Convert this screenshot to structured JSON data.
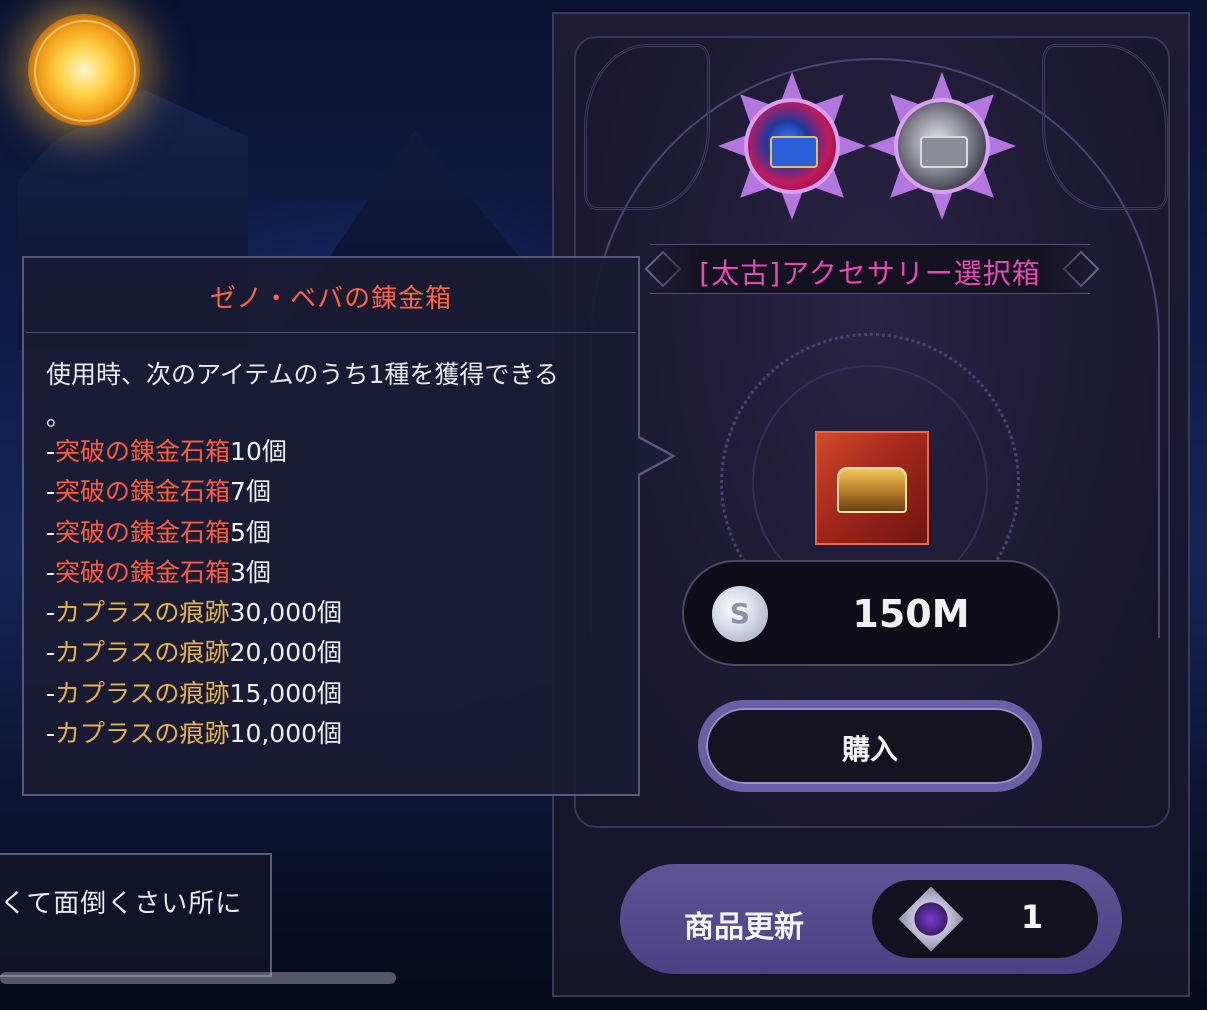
{
  "tooltip": {
    "title": "ゼノ・ベバの錬金箱",
    "description": "使用時、次のアイテムのうち1種を獲得できる",
    "description_tail": "。",
    "rewards": [
      {
        "dash": "-",
        "name": "突破の錬金石箱",
        "qty": "10個",
        "color": "red"
      },
      {
        "dash": "-",
        "name": "突破の錬金石箱",
        "qty": "7個",
        "color": "red"
      },
      {
        "dash": "-",
        "name": "突破の錬金石箱",
        "qty": "5個",
        "color": "red"
      },
      {
        "dash": "-",
        "name": "突破の錬金石箱",
        "qty": "3個",
        "color": "red"
      },
      {
        "dash": "-",
        "name": "カプラスの痕跡",
        "qty": "30,000個",
        "color": "gold"
      },
      {
        "dash": "-",
        "name": "カプラスの痕跡",
        "qty": "20,000個",
        "color": "gold"
      },
      {
        "dash": "-",
        "name": "カプラスの痕跡",
        "qty": "15,000個",
        "color": "gold"
      },
      {
        "dash": "-",
        "name": "カプラスの痕跡",
        "qty": "10,000個",
        "color": "gold"
      }
    ]
  },
  "shop": {
    "product_title": "[太古]アクセサリー選択箱",
    "price": "150M",
    "currency_icon": "silver-coin-icon",
    "currency_symbol": "S",
    "buy_label": "購入",
    "refresh_label": "商品更新",
    "refresh_cost": "1",
    "refresh_icon": "purple-gem-icon"
  },
  "background": {
    "dialog_text": "くて面倒くさい所に"
  },
  "colors": {
    "tooltip_title": "#ff6346",
    "reward_red": "#ff5a3c",
    "reward_gold": "#e6b34a",
    "product_title": "#e64ab8",
    "panel_accent": "#6b5fa6"
  }
}
